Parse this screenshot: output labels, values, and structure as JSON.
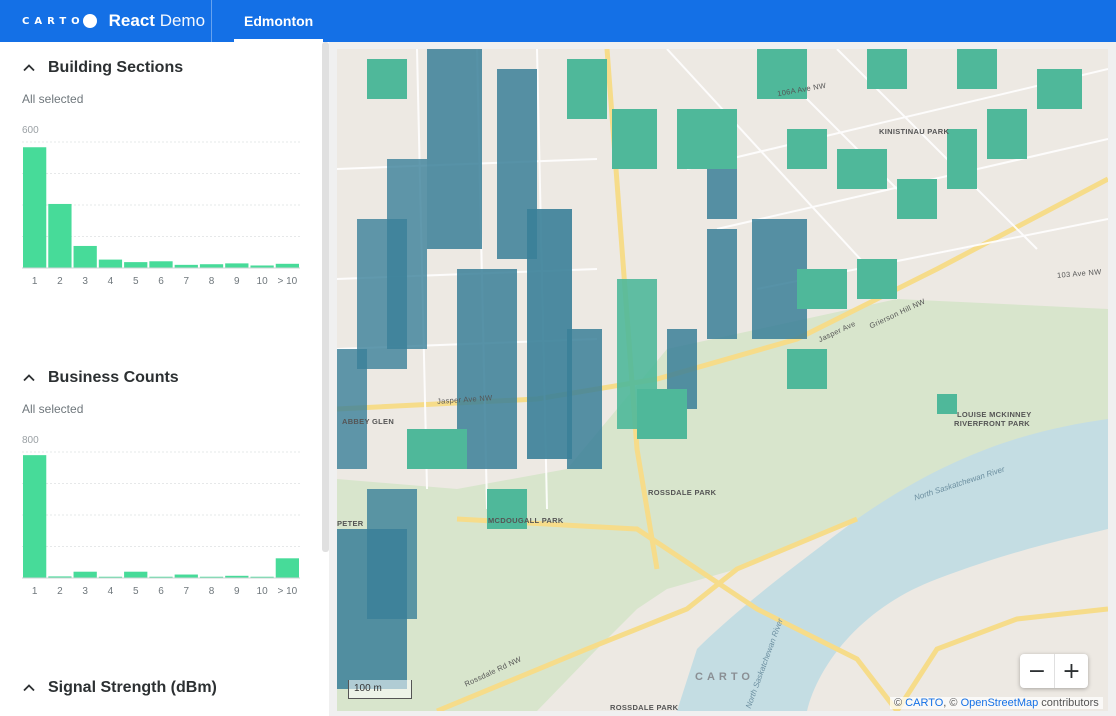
{
  "header": {
    "logo_text": "CARTO",
    "app_name_bold": "React",
    "app_name_light": "Demo",
    "tab_label": "Edmonton"
  },
  "widgets": [
    {
      "title": "Building Sections",
      "status": "All selected",
      "chart_data": {
        "type": "bar",
        "categories": [
          "1",
          "2",
          "3",
          "4",
          "5",
          "6",
          "7",
          "8",
          "9",
          "10",
          "> 10"
        ],
        "values": [
          575,
          305,
          105,
          40,
          28,
          32,
          15,
          18,
          22,
          12,
          20
        ],
        "ymax_label": "600",
        "ylim": [
          0,
          600
        ],
        "grid": true,
        "color": "#47db99"
      }
    },
    {
      "title": "Business Counts",
      "status": "All selected",
      "chart_data": {
        "type": "bar",
        "categories": [
          "1",
          "2",
          "3",
          "4",
          "5",
          "6",
          "7",
          "8",
          "9",
          "10",
          "> 10"
        ],
        "values": [
          780,
          10,
          40,
          8,
          40,
          8,
          22,
          8,
          14,
          8,
          125
        ],
        "ymax_label": "800",
        "ylim": [
          0,
          800
        ],
        "grid": true,
        "color": "#47db99"
      }
    },
    {
      "title": "Signal Strength (dBm)"
    }
  ],
  "map": {
    "labels": [
      "KINISTINAU PARK",
      "LOUISE MCKINNEY",
      "RIVERFRONT PARK",
      "ROSSDALE PARK",
      "MCDOUGALL PARK",
      "ABBEY GLEN",
      "ROSSDALE PARK",
      "PETER"
    ],
    "street_labels": [
      "Jasper Ave NW",
      "Jasper Ave",
      "Grierson Hill NW",
      "Rossdale Rd NW",
      "106A Ave NW",
      "103 Ave NW"
    ],
    "water_labels": [
      "North Saskatchewan River",
      "North Saskatchewan River"
    ],
    "watermark": "CARTO",
    "scale_label": "100 m",
    "zoom_out": "−",
    "zoom_in": "+",
    "attribution_prefix": "© ",
    "attribution_carto": "CARTO",
    "attribution_mid": ", © ",
    "attribution_osm": "OpenStreetMap",
    "attribution_suffix": " contributors"
  },
  "colors": {
    "header": "#1470e6",
    "bar": "#47db99",
    "building_light": "#4fb89a",
    "building_dark": "#3a7f98"
  },
  "icons": {
    "collapse": "chevron-up-icon"
  }
}
